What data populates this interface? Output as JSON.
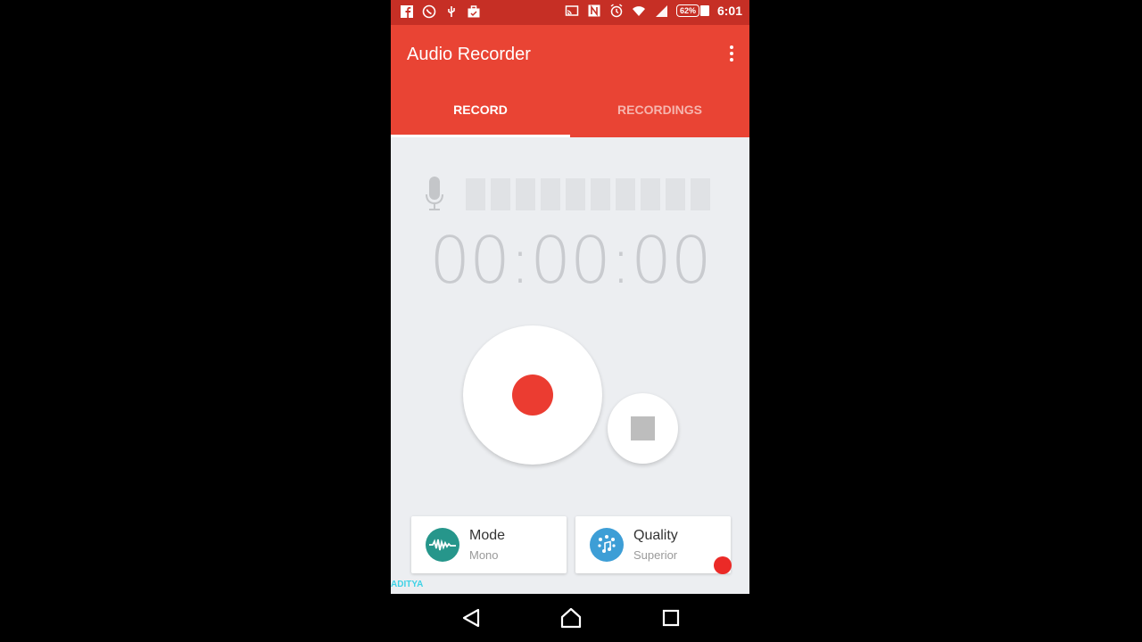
{
  "status_bar": {
    "left_icons": [
      "facebook-icon",
      "whatsapp-icon",
      "usb-icon",
      "briefcase-icon"
    ],
    "right_icons": [
      "cast-icon",
      "nfc-icon",
      "alarm-icon",
      "wifi-icon",
      "signal-icon"
    ],
    "battery_percent": "62%",
    "time": "6:01"
  },
  "app_bar": {
    "title": "Audio Recorder",
    "menu_icon": "more-vert-icon"
  },
  "tabs": [
    {
      "label": "RECORD",
      "active": true
    },
    {
      "label": "RECORDINGS",
      "active": false
    }
  ],
  "recorder": {
    "mic_icon": "microphone-icon",
    "level_meter_segments": 10,
    "level_meter_active": 0,
    "timer": "00:00:00",
    "record_button": "record-icon",
    "stop_button": "stop-icon"
  },
  "settings": {
    "mode": {
      "title": "Mode",
      "value": "Mono",
      "icon": "waveform-icon"
    },
    "quality": {
      "title": "Quality",
      "value": "Superior",
      "icon": "music-note-icon"
    }
  },
  "watermark": "ADITYA",
  "nav_bar": {
    "back": "back-icon",
    "home": "home-icon",
    "recents": "recents-icon"
  },
  "colors": {
    "status_bar": "#c62f25",
    "app_bar": "#e94434",
    "record_accent": "#eb3c31",
    "mode_icon_bg": "#26968b",
    "quality_icon_bg": "#3d9ed6"
  }
}
